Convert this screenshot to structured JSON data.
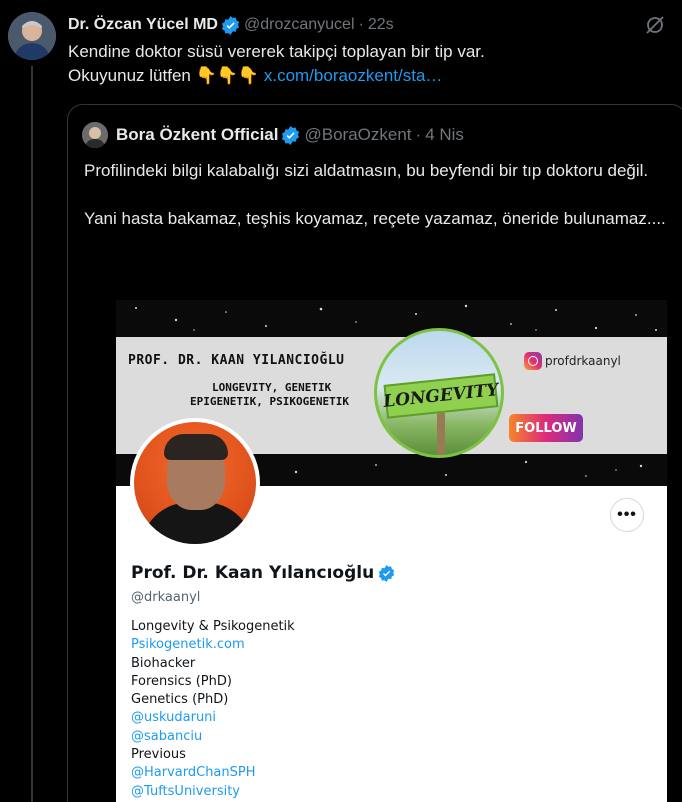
{
  "tweet": {
    "author_name": "Dr. Özcan Yücel MD",
    "handle": "@drozcanyucel",
    "time": "22s",
    "text_line1": "Kendine doktor süsü vererek takipçi toplayan bir tip var.",
    "text_line2_prefix": "Okuyunuz lütfen",
    "emojis": "👇👇👇",
    "link": "x.com/boraozkent/sta…"
  },
  "quote": {
    "author_name": "Bora Özkent Official",
    "handle": "@BoraOzkent",
    "time": "4 Nis",
    "paragraph1": "Profilindeki bilgi kalabalığı sizi aldatmasın, bu beyfendi bir tıp doktoru değil.",
    "paragraph2": "Yani hasta bakamaz, teşhis koyamaz, reçete yazamaz, öneride bulunamaz...."
  },
  "embedded_profile": {
    "banner_name": "PROF. DR. KAAN YILANCIOĞLU",
    "banner_subtitle_1": "LONGEVITY, GENETIK",
    "banner_subtitle_2": "EPIGENETIK, PSIKOGENETIK",
    "banner_sign": "LONGEVITY",
    "instagram_handle": "profdrkaanyl",
    "follow_label": "FOLLOW",
    "more_label": "•••",
    "name": "Prof. Dr. Kaan Yılancıoğlu",
    "handle": "@drkaanyl",
    "bio": [
      {
        "text": "Longevity & Psikogenetik",
        "link": false
      },
      {
        "text": "Psikogenetik.com",
        "link": true
      },
      {
        "text": "Biohacker",
        "link": false
      },
      {
        "text": "Forensics (PhD)",
        "link": false
      },
      {
        "text": "Genetics (PhD)",
        "link": false
      },
      {
        "text": "@uskudaruni",
        "link": true
      },
      {
        "text": "@sabanciu",
        "link": true
      },
      {
        "text": "Previous",
        "link": false
      },
      {
        "text": "@HarvardChanSPH",
        "link": true
      },
      {
        "text": "@TuftsUniversity",
        "link": true
      }
    ]
  },
  "colors": {
    "background": "#000000",
    "text": "#e7e9ea",
    "muted": "#71767b",
    "link": "#1d9bf0",
    "border": "#333639",
    "verified": "#1d9bf0"
  },
  "icons": [
    "verified-badge-icon",
    "grok-icon",
    "instagram-icon",
    "more-icon"
  ]
}
